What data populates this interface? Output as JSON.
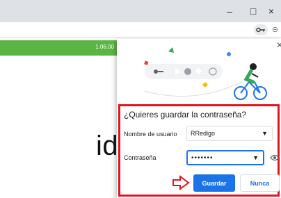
{
  "window": {
    "minimize_label": "–",
    "maximize_label": "□",
    "close_label": "×"
  },
  "toolbar": {
    "key_icon": "key-icon",
    "more_icon": "more-icon"
  },
  "page": {
    "version_text": "1.06.00",
    "partial_word": "idional",
    "accent_color": "#5bb544"
  },
  "dialog": {
    "title": "¿Quieres guardar la contraseña?",
    "username_label": "Nombre de usuario",
    "username_value": "RRedigo",
    "password_label": "Contraseña",
    "password_value": "•••••••",
    "save_label": "Guardar",
    "never_label": "Nunca",
    "highlight_color": "#e4141d",
    "primary_color": "#1a73e8"
  }
}
